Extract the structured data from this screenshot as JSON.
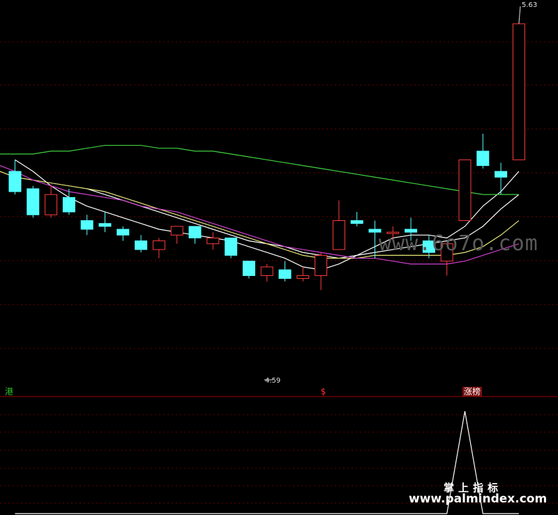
{
  "chart_data": {
    "type": "candlestick",
    "price_range": [
      4.4,
      5.7
    ],
    "high_label": "5.63",
    "low_label": "4.59",
    "candles": [
      {
        "o": 5.12,
        "h": 5.16,
        "l": 5.04,
        "c": 5.05,
        "color": "cyan"
      },
      {
        "o": 5.06,
        "h": 5.07,
        "l": 4.96,
        "c": 4.97,
        "color": "cyan"
      },
      {
        "o": 4.97,
        "h": 5.07,
        "l": 4.96,
        "c": 5.04,
        "color": "red"
      },
      {
        "o": 5.03,
        "h": 5.06,
        "l": 4.97,
        "c": 4.98,
        "color": "cyan"
      },
      {
        "o": 4.95,
        "h": 4.97,
        "l": 4.9,
        "c": 4.92,
        "color": "cyan"
      },
      {
        "o": 4.94,
        "h": 4.98,
        "l": 4.91,
        "c": 4.93,
        "color": "cyan"
      },
      {
        "o": 4.92,
        "h": 4.93,
        "l": 4.88,
        "c": 4.9,
        "color": "cyan"
      },
      {
        "o": 4.88,
        "h": 4.9,
        "l": 4.84,
        "c": 4.85,
        "color": "cyan"
      },
      {
        "o": 4.85,
        "h": 4.89,
        "l": 4.82,
        "c": 4.88,
        "color": "red"
      },
      {
        "o": 4.9,
        "h": 4.93,
        "l": 4.87,
        "c": 4.93,
        "color": "red"
      },
      {
        "o": 4.93,
        "h": 4.93,
        "l": 4.87,
        "c": 4.89,
        "color": "cyan"
      },
      {
        "o": 4.87,
        "h": 4.91,
        "l": 4.85,
        "c": 4.89,
        "color": "red"
      },
      {
        "o": 4.89,
        "h": 4.89,
        "l": 4.82,
        "c": 4.83,
        "color": "cyan"
      },
      {
        "o": 4.81,
        "h": 4.81,
        "l": 4.75,
        "c": 4.76,
        "color": "cyan"
      },
      {
        "o": 4.76,
        "h": 4.8,
        "l": 4.74,
        "c": 4.79,
        "color": "red"
      },
      {
        "o": 4.78,
        "h": 4.81,
        "l": 4.74,
        "c": 4.75,
        "color": "cyan"
      },
      {
        "o": 4.75,
        "h": 4.79,
        "l": 4.74,
        "c": 4.76,
        "color": "red"
      },
      {
        "o": 4.76,
        "h": 4.84,
        "l": 4.71,
        "c": 4.83,
        "color": "red"
      },
      {
        "o": 4.85,
        "h": 5.02,
        "l": 4.85,
        "c": 4.95,
        "color": "red"
      },
      {
        "o": 4.95,
        "h": 4.98,
        "l": 4.93,
        "c": 4.94,
        "color": "cyan"
      },
      {
        "o": 4.92,
        "h": 4.95,
        "l": 4.82,
        "c": 4.91,
        "color": "cyan"
      },
      {
        "o": 4.91,
        "h": 4.93,
        "l": 4.88,
        "c": 4.91,
        "color": "red"
      },
      {
        "o": 4.92,
        "h": 4.96,
        "l": 4.88,
        "c": 4.91,
        "color": "cyan"
      },
      {
        "o": 4.88,
        "h": 4.9,
        "l": 4.82,
        "c": 4.84,
        "color": "cyan"
      },
      {
        "o": 4.81,
        "h": 4.87,
        "l": 4.76,
        "c": 4.87,
        "color": "red"
      },
      {
        "o": 4.95,
        "h": 5.16,
        "l": 4.95,
        "c": 5.16,
        "color": "red"
      },
      {
        "o": 5.19,
        "h": 5.25,
        "l": 5.13,
        "c": 5.14,
        "color": "cyan"
      },
      {
        "o": 5.12,
        "h": 5.15,
        "l": 5.04,
        "c": 5.1,
        "color": "cyan"
      },
      {
        "o": 5.16,
        "h": 5.63,
        "l": 5.16,
        "c": 5.63,
        "color": "red"
      }
    ],
    "ma_lines": [
      {
        "color": "#ffffff",
        "values": [
          5.16,
          5.12,
          5.07,
          5.03,
          5.0,
          4.98,
          4.96,
          4.94,
          4.92,
          4.91,
          4.9,
          4.89,
          4.88,
          4.86,
          4.84,
          4.82,
          4.79,
          4.78,
          4.8,
          4.83,
          4.86,
          4.89,
          4.9,
          4.9,
          4.89,
          4.93,
          5.0,
          5.05,
          5.12
        ]
      },
      {
        "color": "#ffffff",
        "values": [
          null,
          null,
          null,
          null,
          5.06,
          5.04,
          5.02,
          5.0,
          4.98,
          4.96,
          4.94,
          4.92,
          4.9,
          4.88,
          4.87,
          4.86,
          4.84,
          4.83,
          4.82,
          4.83,
          4.84,
          4.85,
          4.86,
          4.87,
          4.88,
          4.89,
          4.93,
          4.99,
          5.04
        ]
      },
      {
        "color": "#e6e67a",
        "values": [
          5.1,
          5.09,
          5.08,
          5.07,
          5.06,
          5.05,
          5.03,
          5.01,
          4.99,
          4.97,
          4.95,
          4.93,
          4.91,
          4.89,
          4.87,
          4.85,
          4.83,
          4.82,
          4.82,
          4.82,
          4.83,
          4.83,
          4.83,
          4.83,
          4.83,
          4.84,
          4.86,
          4.9,
          4.95
        ]
      },
      {
        "color": "#d040d0",
        "values": [
          5.12,
          5.09,
          5.07,
          5.05,
          5.04,
          5.03,
          5.02,
          5.0,
          4.99,
          4.98,
          4.96,
          4.94,
          4.92,
          4.9,
          4.88,
          4.86,
          4.85,
          4.84,
          4.83,
          4.82,
          4.82,
          4.81,
          4.8,
          4.8,
          4.8,
          4.81,
          4.83,
          4.85,
          4.87
        ]
      },
      {
        "color": "#40d040",
        "values": [
          5.18,
          5.18,
          5.19,
          5.19,
          5.2,
          5.21,
          5.21,
          5.21,
          5.2,
          5.2,
          5.19,
          5.19,
          5.18,
          5.17,
          5.16,
          5.15,
          5.14,
          5.13,
          5.12,
          5.11,
          5.1,
          5.09,
          5.08,
          5.07,
          5.06,
          5.05,
          5.04,
          5.04,
          5.04
        ]
      }
    ],
    "signal_markers": [
      {
        "label": "港",
        "index": 0,
        "color": "#30c030"
      },
      {
        "label": "$",
        "index": 17,
        "color": "#ff3030"
      },
      {
        "label": "涨榜",
        "index": 25,
        "color": "#ffffff"
      }
    ],
    "indicator": {
      "type": "line",
      "values": [
        0,
        0,
        0,
        0,
        0,
        0,
        0,
        0,
        0,
        0,
        0,
        0,
        0,
        0,
        0,
        0,
        0,
        0,
        0,
        0,
        0,
        0,
        0,
        0,
        0,
        1,
        0,
        0,
        0
      ]
    }
  },
  "watermark_top": "www.6o7o.com",
  "footer": {
    "title": "掌上指标",
    "url": "www.palmindex.com"
  }
}
